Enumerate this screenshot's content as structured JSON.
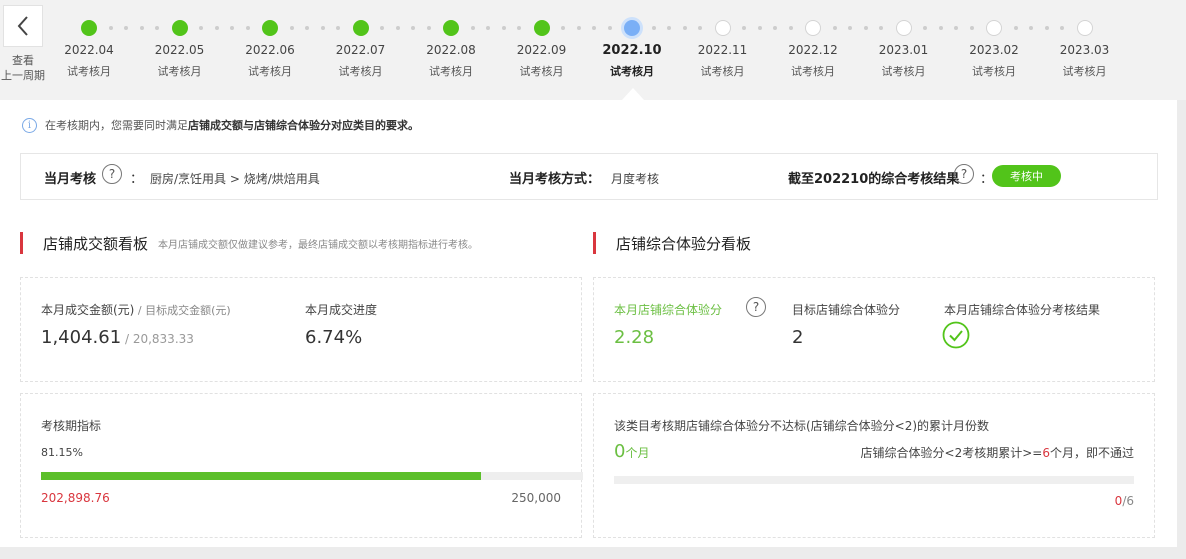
{
  "nav": {
    "back_label": "查看\n上一周期",
    "steps": [
      {
        "date": "2022.04",
        "status": "试考核月",
        "state": "done"
      },
      {
        "date": "2022.05",
        "status": "试考核月",
        "state": "done"
      },
      {
        "date": "2022.06",
        "status": "试考核月",
        "state": "done"
      },
      {
        "date": "2022.07",
        "status": "试考核月",
        "state": "done"
      },
      {
        "date": "2022.08",
        "status": "试考核月",
        "state": "done"
      },
      {
        "date": "2022.09",
        "status": "试考核月",
        "state": "done"
      },
      {
        "date": "2022.10",
        "status": "试考核月",
        "state": "current"
      },
      {
        "date": "2022.11",
        "status": "试考核月",
        "state": "todo"
      },
      {
        "date": "2022.12",
        "status": "试考核月",
        "state": "todo"
      },
      {
        "date": "2023.01",
        "status": "试考核月",
        "state": "todo"
      },
      {
        "date": "2023.02",
        "status": "试考核月",
        "state": "todo"
      },
      {
        "date": "2023.03",
        "status": "试考核月",
        "state": "todo"
      }
    ]
  },
  "notice": {
    "prefix": "在考核期内，您需要同时满足",
    "bold": "店铺成交额与店铺综合体验分对应类目的要求。"
  },
  "summary": {
    "category_label": "当月考核",
    "colon": "：",
    "category_value": "厨房/烹饪用具 > 烧烤/烘焙用具",
    "method_label": "当月考核方式：",
    "method_value": "月度考核",
    "result_label": "截至202210的综合考核结果",
    "result_badge": "考核中"
  },
  "sales": {
    "title": "店铺成交额看板",
    "hint": "本月店铺成交额仅做建议参考，最终店铺成交额以考核期指标进行考核。",
    "amount_label": "本月成交金额(元)",
    "target_label": " / 目标成交金额(元)",
    "amount_value": "1,404.61",
    "target_sep": " / ",
    "target_value": "20,833.33",
    "progress_label": "本月成交进度",
    "progress_value": "6.74%",
    "period_label": "考核期指标",
    "period_percent": "81.15%",
    "period_fraction": 0.8115,
    "period_current": "202,898.76",
    "period_target": "250,000"
  },
  "exp": {
    "title": "店铺综合体验分看板",
    "score_label": "本月店铺综合体验分",
    "score_value": "2.28",
    "target_label": "目标店铺综合体验分",
    "target_value": "2",
    "result_label": "本月店铺综合体验分考核结果",
    "sub_title": "该类目考核期店铺综合体验分不达标(店铺综合体验分<2)的累计月份数",
    "months_value": "0",
    "months_unit": "个月",
    "rule_prefix": "店铺综合体验分<2考核期累计>=",
    "rule_num": "6",
    "rule_suffix": "个月，即不通过",
    "count_num": "0",
    "count_total": "/6"
  },
  "colors": {
    "green": "#52c41a",
    "red": "#d9363e",
    "blue": "#7aaff6"
  }
}
